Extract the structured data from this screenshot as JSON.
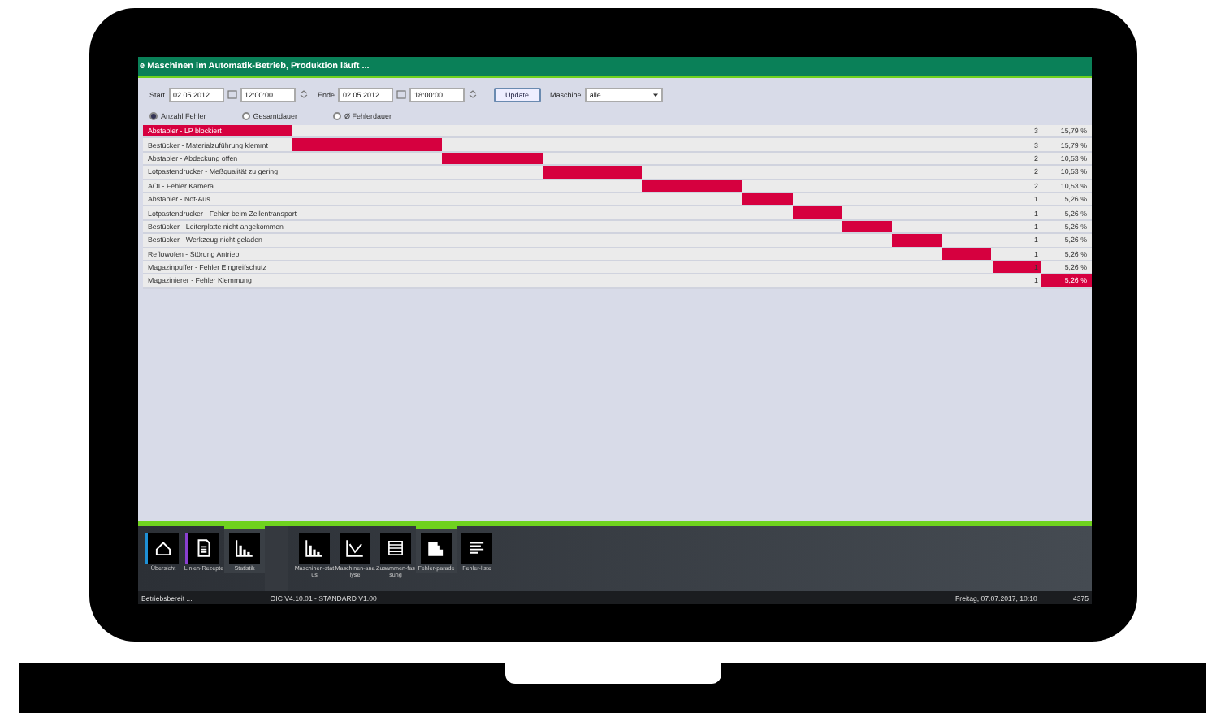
{
  "header": {
    "title": "e Maschinen im Automatik-Betrieb, Produktion läuft ..."
  },
  "filter": {
    "start_label": "Start",
    "start_date": "02.05.2012",
    "start_time": "12:00:00",
    "end_label": "Ende",
    "end_date": "02.05.2012",
    "end_time": "18:00:00",
    "update_button": "Update",
    "machine_label": "Maschine",
    "machine_value": "alle"
  },
  "modes": [
    {
      "label": "Anzahl Fehler",
      "selected": true
    },
    {
      "label": "Gesamtdauer",
      "selected": false
    },
    {
      "label": "Ø Fehlerdauer",
      "selected": false
    }
  ],
  "rows": [
    {
      "label": "Abstapler - LP blockiert",
      "count": "3",
      "percent": "15,79 %"
    },
    {
      "label": "Bestücker - Materialzuführung klemmt",
      "count": "3",
      "percent": "15,79 %"
    },
    {
      "label": "Abstapler - Abdeckung offen",
      "count": "2",
      "percent": "10,53 %"
    },
    {
      "label": "Lotpastendrucker - Meßqualität zu gering",
      "count": "2",
      "percent": "10,53 %"
    },
    {
      "label": "AOI - Fehler Kamera",
      "count": "2",
      "percent": "10,53 %"
    },
    {
      "label": "Abstapler - Not-Aus",
      "count": "1",
      "percent": "5,26 %"
    },
    {
      "label": "Lotpastendrucker - Fehler beim Zellentransport",
      "count": "1",
      "percent": "5,26 %"
    },
    {
      "label": "Bestücker - Leiterplatte nicht angekommen",
      "count": "1",
      "percent": "5,26 %"
    },
    {
      "label": "Bestücker - Werkzeug nicht geladen",
      "count": "1",
      "percent": "5,26 %"
    },
    {
      "label": "Reflowofen - Störung Antrieb",
      "count": "1",
      "percent": "5,26 %"
    },
    {
      "label": "Magazinpuffer - Fehler Eingreifschutz",
      "count": "1",
      "percent": "5,26 %"
    },
    {
      "label": "Magazinierer - Fehler Klemmung",
      "count": "1",
      "percent": "5,26 %"
    }
  ],
  "toolbar_main": [
    {
      "label": "Übersicht",
      "kind": "home",
      "color": "#1e90d6",
      "selected": false
    },
    {
      "label": "Linien-Rezepte",
      "kind": "doc",
      "color": "#8a3fd0",
      "selected": false
    },
    {
      "label": "Statistik",
      "kind": "bars",
      "color": "#6fd21e",
      "selected": true
    }
  ],
  "toolbar_sub": [
    {
      "label": "Maschinen-status",
      "kind": "bars",
      "selected": false
    },
    {
      "label": "Maschinen-analyse",
      "kind": "check",
      "selected": false
    },
    {
      "label": "Zusammen-fassung",
      "kind": "list",
      "selected": false
    },
    {
      "label": "Fehler-parade",
      "kind": "stairs",
      "selected": true
    },
    {
      "label": "Fehler-liste",
      "kind": "lines",
      "selected": false
    }
  ],
  "status_bar": {
    "state": "Betriebsbereit ...",
    "version": "OIC V4.10.01 - STANDARD V1.00",
    "datetime": "Freitag, 07.07.2017, 10:10",
    "user": "4375"
  }
}
